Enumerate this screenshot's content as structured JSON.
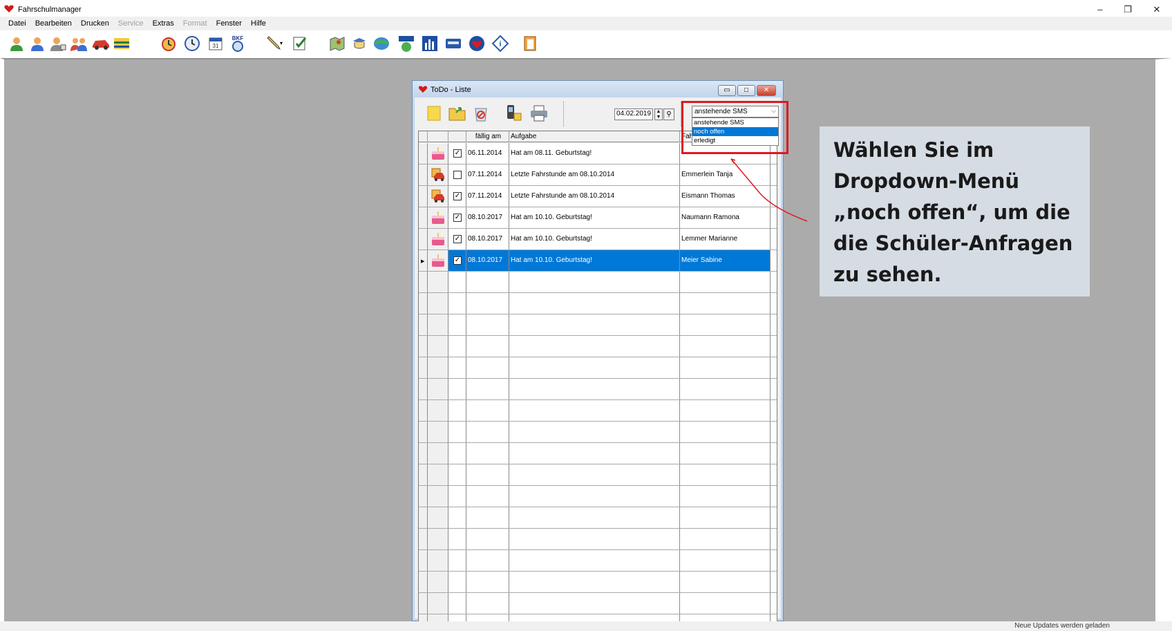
{
  "app": {
    "title": "Fahrschulmanager",
    "window_controls": {
      "minimize": "–",
      "restore": "❐",
      "close": "✕"
    }
  },
  "menu": [
    {
      "label": "Datei",
      "enabled": true
    },
    {
      "label": "Bearbeiten",
      "enabled": true
    },
    {
      "label": "Drucken",
      "enabled": true
    },
    {
      "label": "Service",
      "enabled": false
    },
    {
      "label": "Extras",
      "enabled": true
    },
    {
      "label": "Format",
      "enabled": false
    },
    {
      "label": "Fenster",
      "enabled": true
    },
    {
      "label": "Hilfe",
      "enabled": true
    }
  ],
  "toolbar_icons": [
    "student-icon",
    "student-add-icon",
    "instructor-icon",
    "group-icon",
    "car-icon",
    "schedule-icon",
    "alarm-icon",
    "clock-icon",
    "calendar-icon",
    "bkf-icon",
    "pen-icon",
    "checklist-icon",
    "map-icon",
    "learning-icon",
    "globe-icon",
    "fahren-lernen-icon",
    "statistics-icon",
    "card-icon",
    "heart-icon",
    "info-diamond-icon",
    "exit-icon"
  ],
  "toolbar_bkf_label": "BKF",
  "todo_window": {
    "title": "ToDo - Liste",
    "date": "04.02.2019",
    "spin_up": "▲",
    "spin_down": "▼",
    "search_glyph": "⚲",
    "filter_selected": "anstehende SMS",
    "filter_options": [
      "anstehende SMS",
      "noch offen",
      "erledigt"
    ],
    "filter_highlighted": "noch offen",
    "columns": [
      "fällig am",
      "Aufgabe",
      "Fah"
    ],
    "rows": [
      {
        "icon": "birthday-cake-icon",
        "checked": true,
        "due": "06.11.2014",
        "task": "Hat am 08.11. Geburtstag!",
        "name": ""
      },
      {
        "icon": "car-lesson-icon",
        "checked": false,
        "due": "07.11.2014",
        "task": "Letzte Fahrstunde am 08.10.2014",
        "name": "Emmerlein Tanja"
      },
      {
        "icon": "car-lesson-icon",
        "checked": true,
        "due": "07.11.2014",
        "task": "Letzte Fahrstunde am 08.10.2014",
        "name": "Eismann Thomas"
      },
      {
        "icon": "birthday-cake-icon",
        "checked": true,
        "due": "08.10.2017",
        "task": "Hat am 10.10. Geburtstag!",
        "name": "Naumann Ramona"
      },
      {
        "icon": "birthday-cake-icon",
        "checked": true,
        "due": "08.10.2017",
        "task": "Hat am 10.10. Geburtstag!",
        "name": "Lemmer Marianne"
      },
      {
        "icon": "birthday-cake-icon",
        "checked": true,
        "due": "08.10.2017",
        "task": "Hat am 10.10. Geburtstag!",
        "name": "Meier Sabine"
      }
    ],
    "selected_row": 5,
    "empty_rows": 17
  },
  "callout": {
    "lines": [
      "Wählen Sie im",
      "Dropdown-Menü",
      "„noch offen“, um die",
      "die Schüler-Anfragen",
      "zu sehen."
    ]
  },
  "status": {
    "text": "Neue Updates werden geladen"
  },
  "colors": {
    "accent": "#0078d7",
    "highlight": "#e0181f",
    "workspace": "#ababab",
    "callout_bg": "#d6dce4"
  }
}
